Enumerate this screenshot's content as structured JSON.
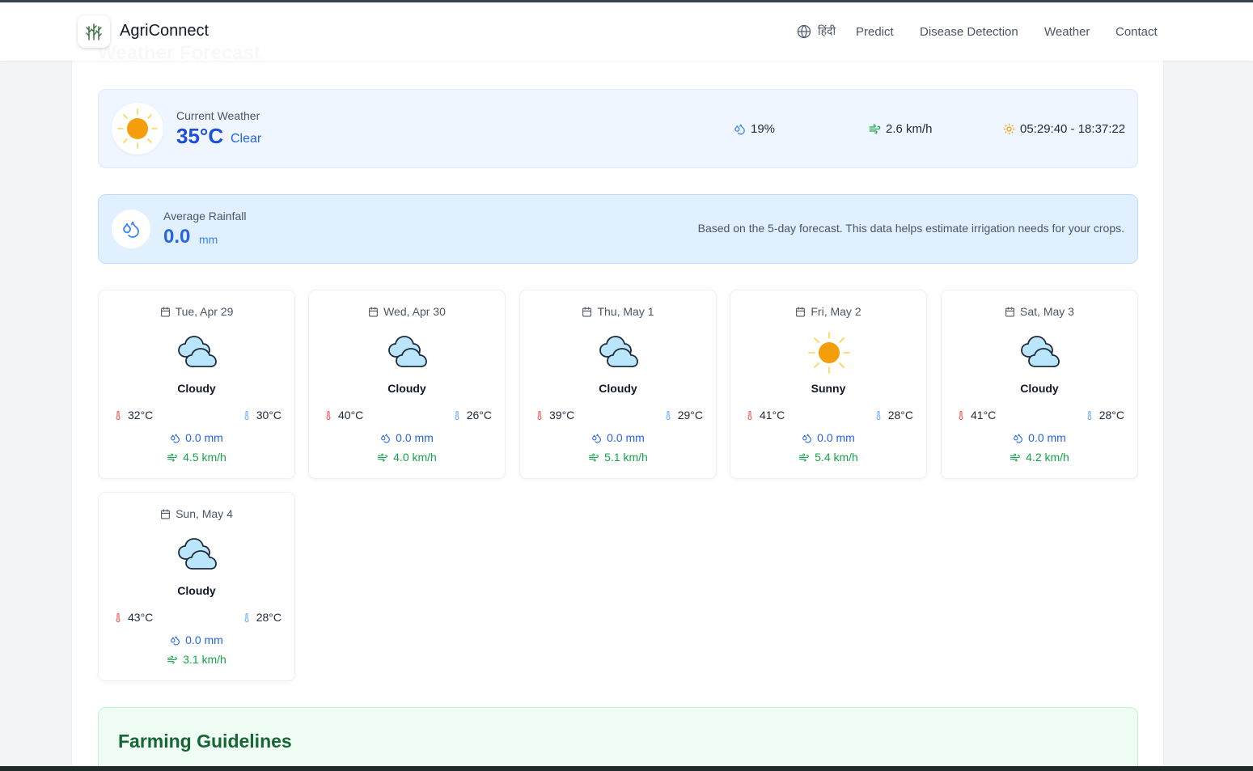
{
  "app": {
    "brand": "AgriConnect",
    "logo_icon": "plant-logo-icon"
  },
  "nav": {
    "language": "हिंदी",
    "links": [
      "Predict",
      "Disease Detection",
      "Weather",
      "Contact"
    ]
  },
  "section": {
    "title": "Weather Forecast"
  },
  "current": {
    "label": "Current Weather",
    "temp": "35°C",
    "condition": "Clear",
    "humidity": "19%",
    "wind": "2.6 km/h",
    "sun_times": "05:29:40 - 18:37:22",
    "icon": "sun-icon"
  },
  "rainfall": {
    "label": "Average Rainfall",
    "value": "0.0",
    "unit": "mm",
    "note": "Based on the 5-day forecast. This data helps estimate irrigation needs for your crops."
  },
  "forecast": [
    {
      "date": "Tue, Apr 29",
      "condition": "Cloudy",
      "high": "32°C",
      "low": "30°C",
      "rain": "0.0 mm",
      "wind": "4.5 km/h",
      "icon": "cloud-icon"
    },
    {
      "date": "Wed, Apr 30",
      "condition": "Cloudy",
      "high": "40°C",
      "low": "26°C",
      "rain": "0.0 mm",
      "wind": "4.0 km/h",
      "icon": "cloud-icon"
    },
    {
      "date": "Thu, May 1",
      "condition": "Cloudy",
      "high": "39°C",
      "low": "29°C",
      "rain": "0.0 mm",
      "wind": "5.1 km/h",
      "icon": "cloud-icon"
    },
    {
      "date": "Fri, May 2",
      "condition": "Sunny",
      "high": "41°C",
      "low": "28°C",
      "rain": "0.0 mm",
      "wind": "5.4 km/h",
      "icon": "sun-icon"
    },
    {
      "date": "Sat, May 3",
      "condition": "Cloudy",
      "high": "41°C",
      "low": "28°C",
      "rain": "0.0 mm",
      "wind": "4.2 km/h",
      "icon": "cloud-icon"
    },
    {
      "date": "Sun, May 4",
      "condition": "Cloudy",
      "high": "43°C",
      "low": "28°C",
      "rain": "0.0 mm",
      "wind": "3.1 km/h",
      "icon": "cloud-icon"
    }
  ],
  "guidelines": {
    "title": "Farming Guidelines"
  },
  "colors": {
    "accent_blue": "#2563eb",
    "wind_green": "#16a34a",
    "sun_orange": "#f59e0b",
    "heading_green": "#166534"
  }
}
